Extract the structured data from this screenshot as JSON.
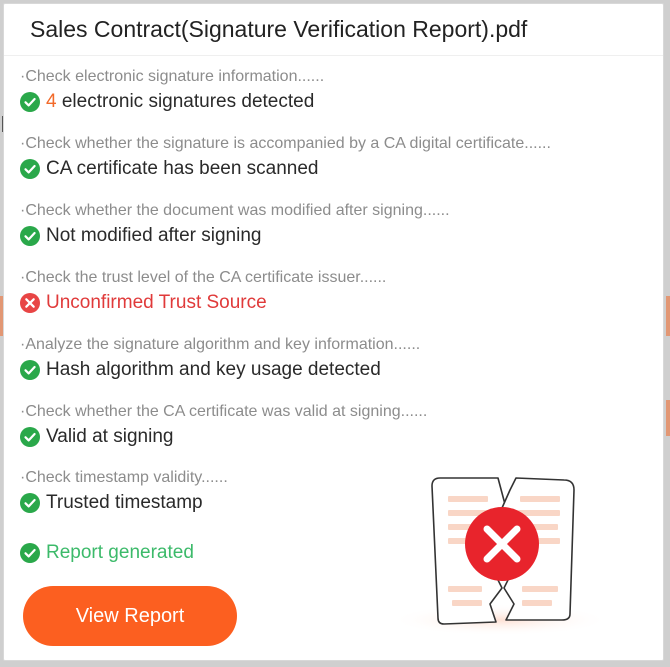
{
  "dialog": {
    "title": "Sales Contract(Signature Verification Report).pdf"
  },
  "steps": [
    {
      "description": "·Check electronic signature information......",
      "status": "pass",
      "result_count": "4",
      "result_text": " electronic signatures detected"
    },
    {
      "description": "·Check whether the signature is accompanied by a CA digital certificate......",
      "status": "pass",
      "result_text": "CA certificate has been scanned"
    },
    {
      "description": "·Check whether the document was modified after signing......",
      "status": "pass",
      "result_text": "Not modified after signing"
    },
    {
      "description": "·Check the trust level of the CA certificate issuer......",
      "status": "fail",
      "result_text": "Unconfirmed Trust Source"
    },
    {
      "description": "·Analyze the signature algorithm and key information......",
      "status": "pass",
      "result_text": "Hash algorithm and key usage detected"
    },
    {
      "description": "·Check whether the CA certificate was valid at signing......",
      "status": "pass",
      "result_text": "Valid at signing"
    },
    {
      "description": "·Check timestamp validity......",
      "status": "pass",
      "result_text": "Trusted timestamp"
    }
  ],
  "final_status": {
    "status": "pass",
    "text": "Report generated"
  },
  "view_report_label": "View Report",
  "colors": {
    "accent": "#fc5f20",
    "pass_green": "#2aa84a",
    "fail_red": "#e03a3a",
    "done_text": "#3cba6a"
  },
  "icons": {
    "pass": "check-circle-icon",
    "fail": "x-circle-icon",
    "illustration": "torn-document-error-icon"
  }
}
